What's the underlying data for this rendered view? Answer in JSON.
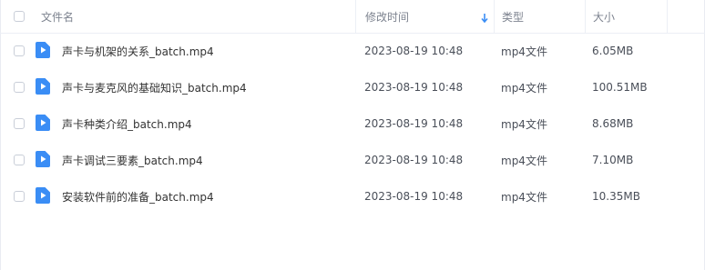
{
  "header": {
    "name_label": "文件名",
    "modified_label": "修改时间",
    "type_label": "类型",
    "size_label": "大小"
  },
  "colors": {
    "file_icon": "#3a8df5",
    "sort_arrow": "#3a8df5"
  },
  "files": [
    {
      "name": "声卡与机架的关系_batch.mp4",
      "modified": "2023-08-19 10:48",
      "type": "mp4文件",
      "size": "6.05MB"
    },
    {
      "name": "声卡与麦克风的基础知识_batch.mp4",
      "modified": "2023-08-19 10:48",
      "type": "mp4文件",
      "size": "100.51MB"
    },
    {
      "name": "声卡种类介绍_batch.mp4",
      "modified": "2023-08-19 10:48",
      "type": "mp4文件",
      "size": "8.68MB"
    },
    {
      "name": "声卡调试三要素_batch.mp4",
      "modified": "2023-08-19 10:48",
      "type": "mp4文件",
      "size": "7.10MB"
    },
    {
      "name": "安装软件前的准备_batch.mp4",
      "modified": "2023-08-19 10:48",
      "type": "mp4文件",
      "size": "10.35MB"
    }
  ]
}
